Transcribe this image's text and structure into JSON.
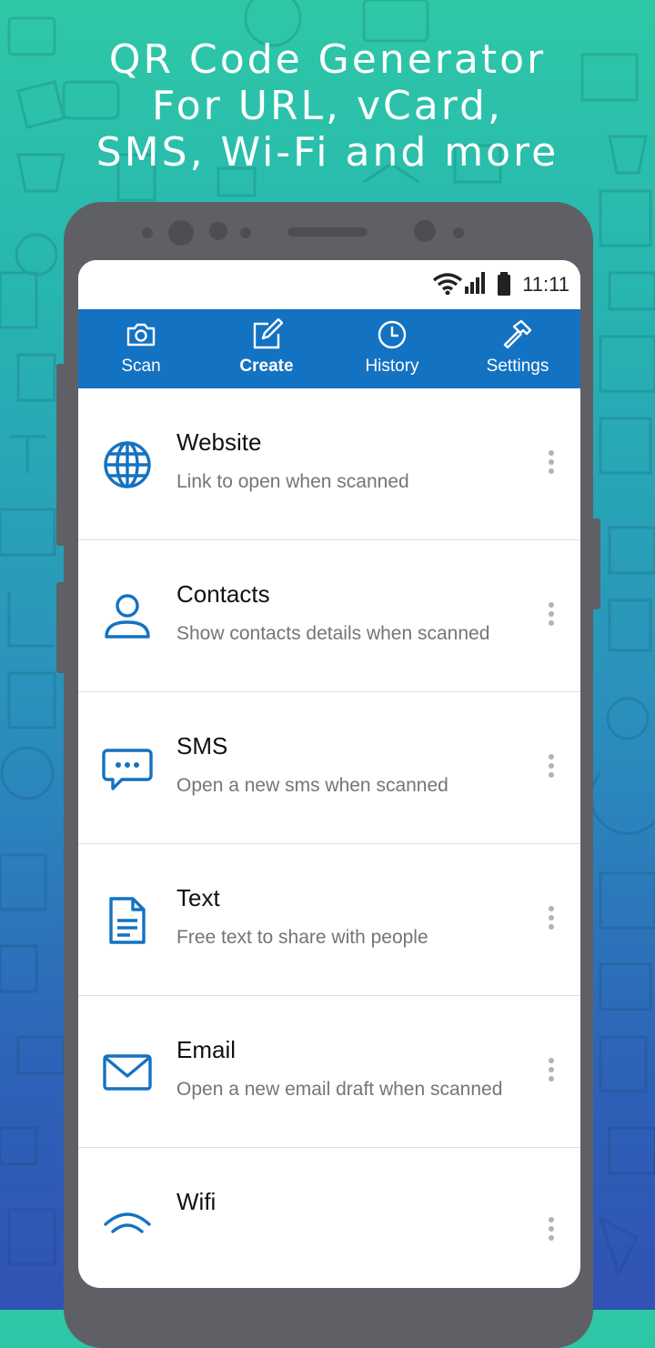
{
  "promo": {
    "headline_line1": "QR Code Generator",
    "headline_line2": "For URL, vCard,",
    "headline_line3": "SMS, Wi-Fi and more"
  },
  "status_bar": {
    "time": "11:11",
    "icons": [
      "wifi-icon",
      "cellular-signal-icon",
      "battery-icon"
    ]
  },
  "tabs": [
    {
      "label": "Scan",
      "icon": "camera-icon",
      "active": false
    },
    {
      "label": "Create",
      "icon": "edit-icon",
      "active": true
    },
    {
      "label": "History",
      "icon": "clock-icon",
      "active": false
    },
    {
      "label": "Settings",
      "icon": "hammer-icon",
      "active": false
    }
  ],
  "items": [
    {
      "title": "Website",
      "subtitle": "Link to open when scanned",
      "icon": "globe-icon"
    },
    {
      "title": "Contacts",
      "subtitle": "Show contacts details when scanned",
      "icon": "person-icon"
    },
    {
      "title": "SMS",
      "subtitle": "Open a new sms when scanned",
      "icon": "message-icon"
    },
    {
      "title": "Text",
      "subtitle": "Free text to share with people",
      "icon": "document-icon"
    },
    {
      "title": "Email",
      "subtitle": "Open a new email draft when scanned",
      "icon": "envelope-icon"
    },
    {
      "title": "Wifi",
      "subtitle": "",
      "icon": "wifi-icon"
    }
  ],
  "colors": {
    "accent": "#1472c2",
    "background_top": "#2ec8a6",
    "background_bottom": "#3052b4"
  }
}
